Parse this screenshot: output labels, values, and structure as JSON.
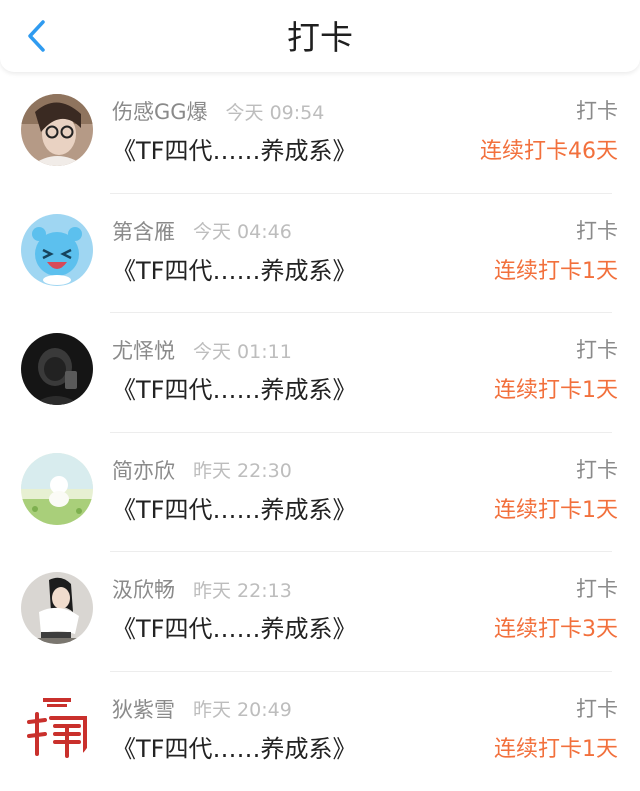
{
  "header": {
    "title": "打卡",
    "back_icon": "chevron-left-icon",
    "accent_color": "#2f9bf0"
  },
  "colors": {
    "streak": "#f2703c",
    "name": "#8a8a8a",
    "time": "#bdbdbd",
    "text": "#222222"
  },
  "entries": [
    {
      "user": "伤感GG爆",
      "time": "今天 09:54",
      "action": "打卡",
      "group": "《TF四代……养成系》",
      "streak": "连续打卡46天"
    },
    {
      "user": "第含雁",
      "time": "今天 04:46",
      "action": "打卡",
      "group": "《TF四代……养成系》",
      "streak": "连续打卡1天"
    },
    {
      "user": "尤怿悦",
      "time": "今天 01:11",
      "action": "打卡",
      "group": "《TF四代……养成系》",
      "streak": "连续打卡1天"
    },
    {
      "user": "简亦欣",
      "time": "昨天 22:30",
      "action": "打卡",
      "group": "《TF四代……养成系》",
      "streak": "连续打卡1天"
    },
    {
      "user": "汲欣畅",
      "time": "昨天 22:13",
      "action": "打卡",
      "group": "《TF四代……养成系》",
      "streak": "连续打卡3天"
    },
    {
      "user": "狄紫雪",
      "time": "昨天 20:49",
      "action": "打卡",
      "group": "《TF四代……养成系》",
      "streak": "连续打卡1天"
    }
  ]
}
